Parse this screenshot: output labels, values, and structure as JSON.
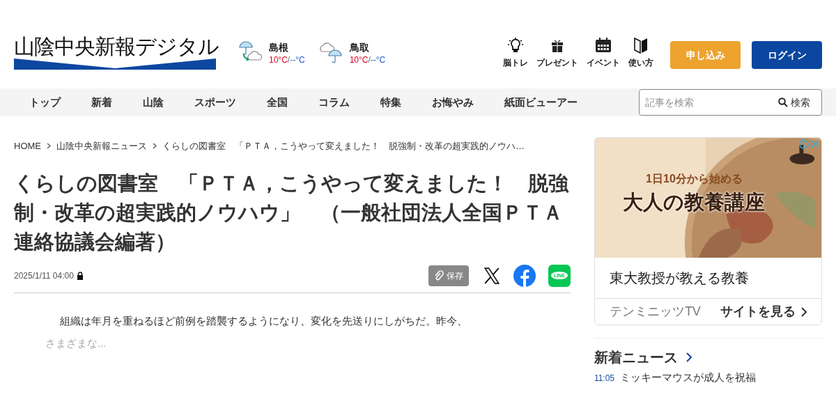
{
  "header": {
    "logo": "山陰中央新報デジタル",
    "weather": [
      {
        "kind": "rain_then_cloud",
        "place": "島根",
        "high": "10°C",
        "separator": "/",
        "low": "--°C"
      },
      {
        "kind": "cloud_then_rain",
        "place": "鳥取",
        "high": "10°C",
        "separator": "/",
        "low": "--°C"
      }
    ],
    "tools": [
      {
        "kind": "bulb",
        "label": "脳トレ"
      },
      {
        "kind": "gift",
        "label": "プレゼント"
      },
      {
        "kind": "calendar",
        "label": "イベント"
      },
      {
        "kind": "book",
        "label": "使い方"
      }
    ],
    "buttons": [
      {
        "kind": "subscribe",
        "label": "申し込み"
      },
      {
        "kind": "login",
        "label": "ログイン"
      }
    ]
  },
  "nav": {
    "items": [
      "トップ",
      "新着",
      "山陰",
      "スポーツ",
      "全国",
      "コラム",
      "特集",
      "お悔やみ",
      "紙面ビューアー"
    ],
    "search": {
      "placeholder": "記事を検索",
      "button": "検索"
    }
  },
  "breadcrumb": [
    "HOME",
    "山陰中央新報ニュース",
    "くらしの図書室　「ＰＴＡ，こうやって変えました！　脱強制・改革の超実践的ノウハ…"
  ],
  "article": {
    "title": "くらしの図書室　「ＰＴＡ，こうやって変えました！　脱強制・改革の超実践的ノウハウ」　（一般社団法人全国ＰＴＡ連絡協議会編著）",
    "date": "2025/1/11 04:00",
    "locked": true,
    "save": "保存",
    "share": [
      {
        "kind": "x"
      },
      {
        "kind": "facebook"
      },
      {
        "kind": "line",
        "label": "LINE"
      }
    ],
    "body": "組織は年月を重ねるほど前例を踏襲するようになり、変化を先送りにしがちだ。昨今、",
    "teaser": "さまざまな..."
  },
  "sidebar": {
    "ad": {
      "kicker": "1日10分から始める",
      "headline": "大人の教養講座",
      "title": "東大教授が教える教養",
      "advertiser": "テンミニッツTV",
      "cta": "サイトを見る"
    },
    "news": {
      "heading": "新着ニュース",
      "items": [
        {
          "time": "11:05",
          "title": "ミッキーマウスが成人を祝福"
        }
      ]
    }
  }
}
